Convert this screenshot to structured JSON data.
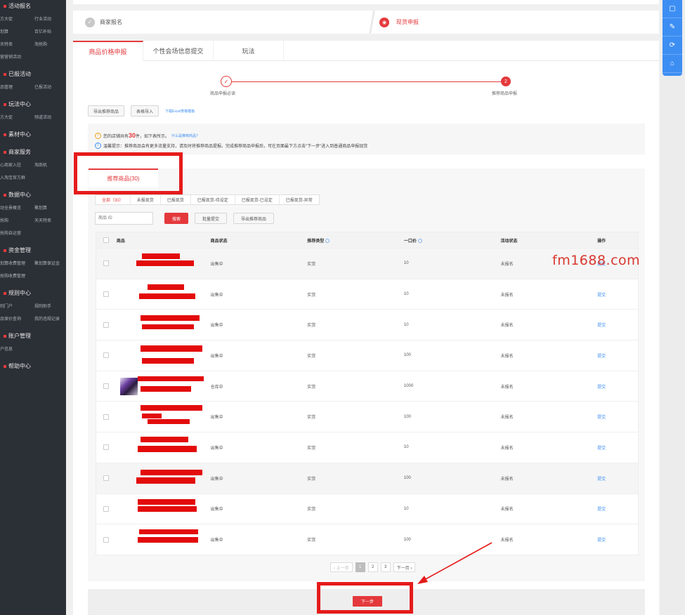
{
  "sidebar": {
    "sections": [
      {
        "title": "活动报名",
        "rows": [
          [
            "方大促",
            "行业活动"
          ],
          [
            "划算",
            "百亿补贴"
          ],
          [
            "天特卖",
            "淘抢购"
          ],
          [
            "营营销活动",
            ""
          ]
        ]
      },
      {
        "title": "已报活动",
        "rows": [
          [
            "品管理",
            "已报活动"
          ]
        ]
      },
      {
        "title": "玩法中心",
        "rows": [
          [
            "方大促",
            "频道活动"
          ]
        ]
      },
      {
        "title": "素材中心",
        "rows": []
      },
      {
        "title": "商家服务",
        "rows": [
          [
            "心商家入驻",
            "淘商机"
          ],
          [
            "入淘宝官方群",
            ""
          ]
        ]
      },
      {
        "title": "数据中心",
        "rows": [
          [
            "动全景概览",
            "聚划算"
          ],
          [
            "抢购",
            "天天特卖"
          ],
          [
            "抢购自运营",
            ""
          ]
        ]
      },
      {
        "title": "资金管理",
        "rows": [
          [
            "划算收费管理",
            "聚划算保证金"
          ],
          [
            "抢购收费管理",
            ""
          ]
        ]
      },
      {
        "title": "规则中心",
        "rows": [
          [
            "则门户",
            "规则助手"
          ],
          [
            "品保价查询",
            "我的违规记录"
          ]
        ]
      },
      {
        "title": "账户管理",
        "rows": [
          [
            "户信息",
            ""
          ]
        ]
      },
      {
        "title": "帮助中心",
        "rows": []
      }
    ]
  },
  "steps": {
    "step1": "商家报名",
    "step2": "现货申报",
    "step1_icon": "✓",
    "step2_icon": "◉"
  },
  "tabs": [
    {
      "label": "商品价格申报"
    },
    {
      "label": "个性会场信息提交"
    },
    {
      "label": "玩法"
    }
  ],
  "progress": {
    "step1_label": "商品申报必读",
    "step2_label": "推荐商品申报",
    "step1_icon": "✓",
    "step2_num": "2"
  },
  "toolbar": {
    "export_label": "导出推荐商品",
    "import_label": "表格导入",
    "download_link": "下载Excel表格模板"
  },
  "notice": {
    "line1_prefix": "您的店铺共有",
    "line1_count": "30",
    "line1_suffix": "件，如下表所示。",
    "line1_link": "什么是推荐商品?",
    "line2": "温馨提示：推荐商品会有更多流量支持，请及时将推荐商品提报。完成推荐商品申报后，可在页面最下方点击\"下一步\"进入到普通商品申报现货"
  },
  "panel": {
    "tab_label": "推荐商品(30)"
  },
  "filters": [
    {
      "label": "全部（30）",
      "active": true
    },
    {
      "label": "未报现货",
      "active": false
    },
    {
      "label": "已报现货",
      "active": false
    },
    {
      "label": "已报现货-待设定",
      "active": false
    },
    {
      "label": "已报现货-已设定",
      "active": false
    },
    {
      "label": "已报现货-异常",
      "active": false
    }
  ],
  "search": {
    "placeholder": "商品 ID",
    "search_label": "搜索",
    "batch_label": "批量提交",
    "export_label": "导出推荐商品"
  },
  "table": {
    "headers": {
      "product": "商品",
      "status": "商品状态",
      "type": "推荐类型",
      "price": "一口价",
      "activity": "活动状态",
      "op": "操作"
    },
    "rows": [
      {
        "status": "出售中",
        "type": "实货",
        "price": "10",
        "activity": "未报名",
        "op": "提交"
      },
      {
        "status": "出售中",
        "type": "实货",
        "price": "10",
        "activity": "未报名",
        "op": "提交"
      },
      {
        "status": "出售中",
        "type": "实货",
        "price": "10",
        "activity": "未报名",
        "op": "提交"
      },
      {
        "status": "出售中",
        "type": "实货",
        "price": "100",
        "activity": "未报名",
        "op": "提交"
      },
      {
        "status": "仓库中",
        "type": "实货",
        "price": "1000",
        "activity": "未报名",
        "op": "提交"
      },
      {
        "status": "出售中",
        "type": "实货",
        "price": "100",
        "activity": "未报名",
        "op": "提交"
      },
      {
        "status": "出售中",
        "type": "实货",
        "price": "10",
        "activity": "未报名",
        "op": "提交"
      },
      {
        "status": "出售中",
        "type": "实货",
        "price": "100",
        "activity": "未报名",
        "op": "提交"
      },
      {
        "status": "出售中",
        "type": "实货",
        "price": "10",
        "activity": "未报名",
        "op": "提交"
      },
      {
        "status": "出售中",
        "type": "实货",
        "price": "100",
        "activity": "未报名",
        "op": "提交"
      }
    ]
  },
  "pager": {
    "prev": "‹ 上一页",
    "pages": [
      "1",
      "2",
      "3"
    ],
    "next": "下一页 ›"
  },
  "footer": {
    "next_label": "下一步"
  },
  "watermark": "fm1688.com",
  "right_bar_icons": [
    "message-icon",
    "tool-icon",
    "refresh-icon",
    "home-icon"
  ],
  "colors": {
    "accent": "#e4393c",
    "link": "#3d8ef3",
    "sidebar_bg": "#2b2f36",
    "highlight": "#e51b1b"
  }
}
